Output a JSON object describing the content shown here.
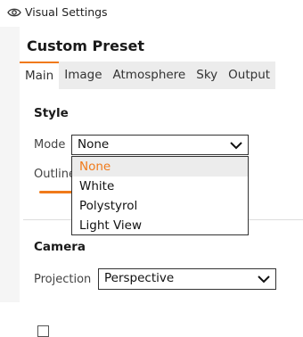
{
  "window": {
    "title": "Visual Settings",
    "icon": "eye-icon"
  },
  "panel": {
    "preset_title": "Custom Preset",
    "tabs": [
      {
        "label": "Main",
        "active": true
      },
      {
        "label": "Image"
      },
      {
        "label": "Atmosphere"
      },
      {
        "label": "Sky"
      },
      {
        "label": "Output"
      }
    ],
    "style": {
      "heading": "Style",
      "mode_label": "Mode",
      "mode_value": "None",
      "outline_label": "Outline",
      "mode_options": [
        "None",
        "White",
        "Polystyrol",
        "Light View"
      ],
      "selected_option": "None"
    },
    "camera": {
      "heading": "Camera",
      "projection_label": "Projection",
      "projection_value": "Perspective"
    }
  },
  "colors": {
    "accent": "#f07a1a",
    "tab_bg": "#ececec",
    "selected_bg": "#ececec"
  }
}
